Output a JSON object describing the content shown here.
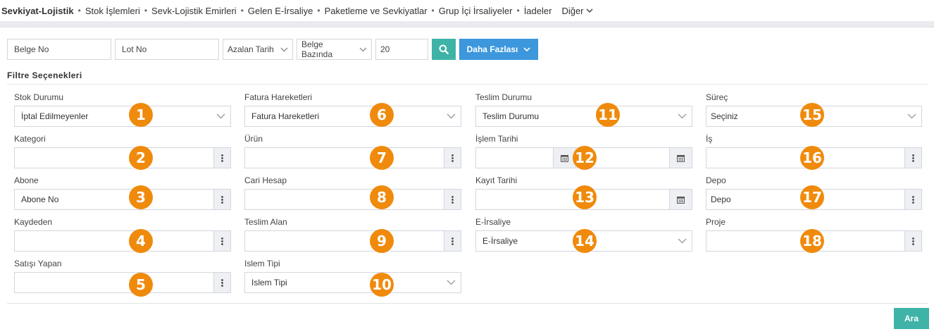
{
  "nav": {
    "brand": "Sevkiyat-Lojistik",
    "items": [
      "Stok İşlemleri",
      "Sevk-Lojistik Emirleri",
      "Gelen E-İrsaliye",
      "Paketleme ve Sevkiyatlar",
      "Grup İçi İrsaliyeler",
      "İadeler"
    ],
    "more": "Diğer"
  },
  "toolbar": {
    "belge_no_placeholder": "Belge No",
    "lot_no_placeholder": "Lot No",
    "sort_value": "Azalan Tarih",
    "basis_value": "Belge Bazında",
    "page_size": "20",
    "more_label": "Daha Fazlası"
  },
  "filter_title": "Filtre Seçenekleri",
  "fields": {
    "stok_durumu": {
      "label": "Stok Durumu",
      "value": "İptal Edilmeyenler",
      "badge": "1"
    },
    "kategori": {
      "label": "Kategori",
      "value": "",
      "badge": "2"
    },
    "abone": {
      "label": "Abone",
      "value": "Abone No",
      "badge": "3"
    },
    "kaydeden": {
      "label": "Kaydeden",
      "value": "",
      "badge": "4"
    },
    "satisi_yapan": {
      "label": "Satışı Yapan",
      "value": "",
      "badge": "5"
    },
    "fatura_hareketleri": {
      "label": "Fatura Hareketleri",
      "value": "Fatura Hareketleri",
      "badge": "6"
    },
    "urun": {
      "label": "Ürün",
      "value": "",
      "badge": "7"
    },
    "cari_hesap": {
      "label": "Cari Hesap",
      "value": "",
      "badge": "8"
    },
    "teslim_alan": {
      "label": "Teslim Alan",
      "value": "",
      "badge": "9"
    },
    "islem_tipi": {
      "label": "Islem Tipi",
      "value": "Islem Tipi",
      "badge": "10"
    },
    "teslim_durumu": {
      "label": "Teslim Durumu",
      "value": "Teslim Durumu",
      "badge": "11"
    },
    "islem_tarihi": {
      "label": "İşlem Tarihi",
      "value": "",
      "badge": "12"
    },
    "kayit_tarihi": {
      "label": "Kayıt Tarihi",
      "value": "",
      "badge": "13"
    },
    "e_irsaliye": {
      "label": "E-İrsaliye",
      "value": "E-İrsaliye",
      "badge": "14"
    },
    "surec": {
      "label": "Süreç",
      "value": "Seçiniz",
      "badge": "15"
    },
    "is": {
      "label": "İş",
      "value": "",
      "badge": "16"
    },
    "depo": {
      "label": "Depo",
      "value": "Depo",
      "badge": "17"
    },
    "proje": {
      "label": "Proje",
      "value": "",
      "badge": "18"
    }
  },
  "ara_label": "Ara",
  "colors": {
    "teal": "#3fb3a7",
    "blue": "#3c97dd",
    "badge_orange": "#f08a0c"
  }
}
